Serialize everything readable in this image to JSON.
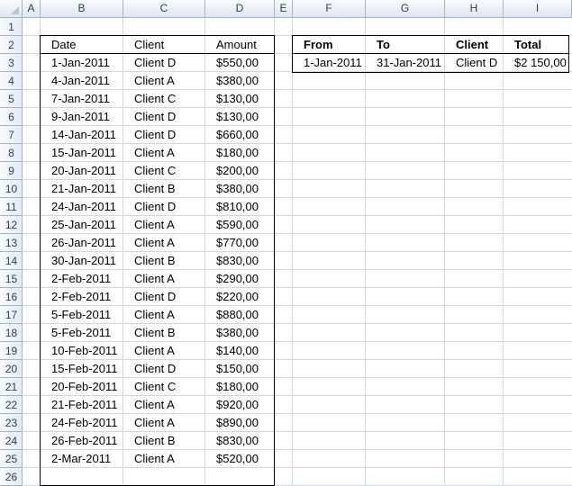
{
  "columns": [
    "A",
    "B",
    "C",
    "D",
    "E",
    "F",
    "G",
    "H",
    "I"
  ],
  "rows": [
    "1",
    "2",
    "3",
    "4",
    "5",
    "6",
    "7",
    "8",
    "9",
    "10",
    "11",
    "12",
    "13",
    "14",
    "15",
    "16",
    "17",
    "18",
    "19",
    "20",
    "21",
    "22",
    "23",
    "24",
    "25",
    "26"
  ],
  "main_table": {
    "headers": [
      "Date",
      "Client",
      "Amount"
    ],
    "rows": [
      [
        "1-Jan-2011",
        "Client D",
        "$550,00"
      ],
      [
        "4-Jan-2011",
        "Client A",
        "$380,00"
      ],
      [
        "7-Jan-2011",
        "Client C",
        "$130,00"
      ],
      [
        "9-Jan-2011",
        "Client D",
        "$130,00"
      ],
      [
        "14-Jan-2011",
        "Client D",
        "$660,00"
      ],
      [
        "15-Jan-2011",
        "Client A",
        "$180,00"
      ],
      [
        "20-Jan-2011",
        "Client C",
        "$200,00"
      ],
      [
        "21-Jan-2011",
        "Client B",
        "$380,00"
      ],
      [
        "24-Jan-2011",
        "Client D",
        "$810,00"
      ],
      [
        "25-Jan-2011",
        "Client A",
        "$590,00"
      ],
      [
        "26-Jan-2011",
        "Client A",
        "$770,00"
      ],
      [
        "30-Jan-2011",
        "Client B",
        "$830,00"
      ],
      [
        "2-Feb-2011",
        "Client A",
        "$290,00"
      ],
      [
        "2-Feb-2011",
        "Client D",
        "$220,00"
      ],
      [
        "5-Feb-2011",
        "Client A",
        "$880,00"
      ],
      [
        "5-Feb-2011",
        "Client B",
        "$380,00"
      ],
      [
        "10-Feb-2011",
        "Client A",
        "$140,00"
      ],
      [
        "15-Feb-2011",
        "Client D",
        "$150,00"
      ],
      [
        "20-Feb-2011",
        "Client C",
        "$180,00"
      ],
      [
        "21-Feb-2011",
        "Client A",
        "$920,00"
      ],
      [
        "24-Feb-2011",
        "Client A",
        "$890,00"
      ],
      [
        "26-Feb-2011",
        "Client B",
        "$830,00"
      ],
      [
        "2-Mar-2011",
        "Client A",
        "$520,00"
      ]
    ]
  },
  "summary_table": {
    "headers": [
      "From",
      "To",
      "Client",
      "Total"
    ],
    "row": [
      "1-Jan-2011",
      "31-Jan-2011",
      "Client D",
      "$2 150,00"
    ]
  }
}
